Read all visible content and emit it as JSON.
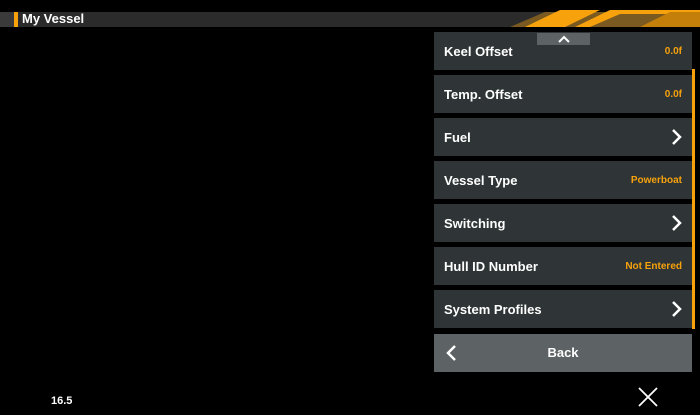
{
  "window": {
    "title": "My Vessel"
  },
  "colors": {
    "accent": "#f7a20c",
    "item_bg": "#2f3436",
    "back_bg": "#5d6264"
  },
  "menu": {
    "items": [
      {
        "label": "Keel Offset",
        "value": "0.0f"
      },
      {
        "label": "Temp. Offset",
        "value": "0.0f"
      },
      {
        "label": "Fuel",
        "icon": "chevron-right-icon"
      },
      {
        "label": "Vessel Type",
        "value": "Powerboat"
      },
      {
        "label": "Switching",
        "icon": "chevron-right-icon"
      },
      {
        "label": "Hull ID Number",
        "value": "Not Entered"
      },
      {
        "label": "System Profiles",
        "icon": "chevron-right-icon"
      }
    ],
    "back_label": "Back"
  },
  "status": {
    "readout": "16.5"
  }
}
